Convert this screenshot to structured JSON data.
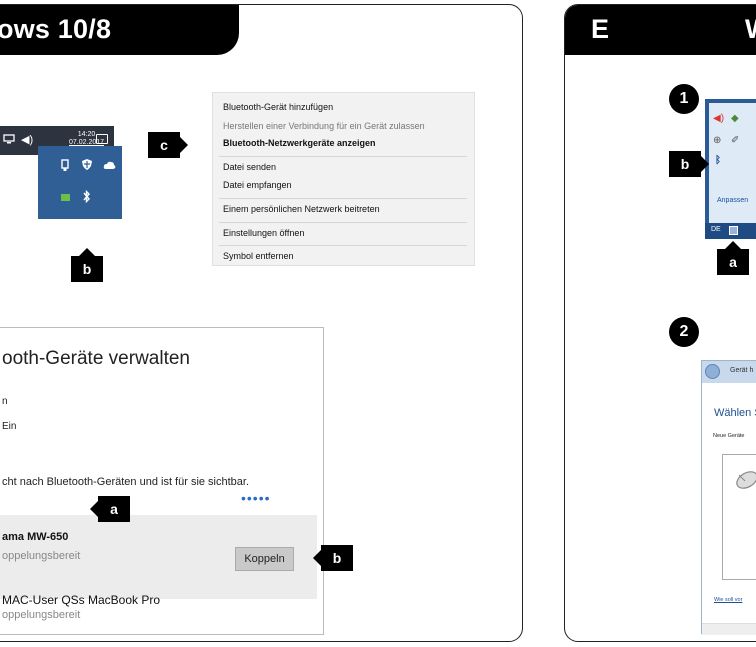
{
  "left": {
    "header": "ows 10/8",
    "taskbar": {
      "time": "14:20",
      "date": "07.02.2017",
      "icons": [
        "chevron-up-icon",
        "network-icon",
        "speaker-icon",
        "notification-icon"
      ]
    },
    "tray": {
      "icons": [
        "usb-icon",
        "shield-icon",
        "cloud-icon",
        "battery-icon",
        "bluetooth-icon"
      ]
    },
    "context_menu": {
      "items": [
        {
          "label": "Bluetooth-Gerät hinzufügen",
          "style": "normal"
        },
        {
          "label": "Herstellen einer Verbindung für ein Gerät zulassen",
          "style": "grey"
        },
        {
          "label": "Bluetooth-Netzwerkgeräte anzeigen",
          "style": "bold"
        },
        {
          "label": "Datei senden",
          "style": "normal"
        },
        {
          "label": "Datei empfangen",
          "style": "normal"
        },
        {
          "label": "Einem persönlichen Netzwerk beitreten",
          "style": "normal"
        },
        {
          "label": "Einstellungen öffnen",
          "style": "normal"
        },
        {
          "label": "Symbol entfernen",
          "style": "normal"
        }
      ]
    },
    "settings": {
      "title": "ooth-Geräte verwalten",
      "line1": "n",
      "line2": "Ein",
      "search_text": "cht nach Bluetooth-Geräten und ist für sie sichtbar.",
      "dots": "•••••",
      "device1_name": "ama MW-650",
      "device1_status": "oppelungsbereit",
      "pair_button": "Koppeln",
      "device2_name": "MAC-User QSs MacBook Pro",
      "device2_status": "oppelungsbereit"
    },
    "tags": {
      "a": "a",
      "b": "b",
      "c": "c"
    }
  },
  "right": {
    "header_letter": "E",
    "header_w": "W",
    "step1": "1",
    "step2": "2",
    "tray_customize": "Anpassen",
    "tray_lang": "DE",
    "wizard": {
      "title": "Gerät h",
      "heading": "Wählen S",
      "sub": "Neue Geräte",
      "link": "Wie soll vor"
    },
    "tags": {
      "a": "a",
      "b": "b"
    }
  }
}
